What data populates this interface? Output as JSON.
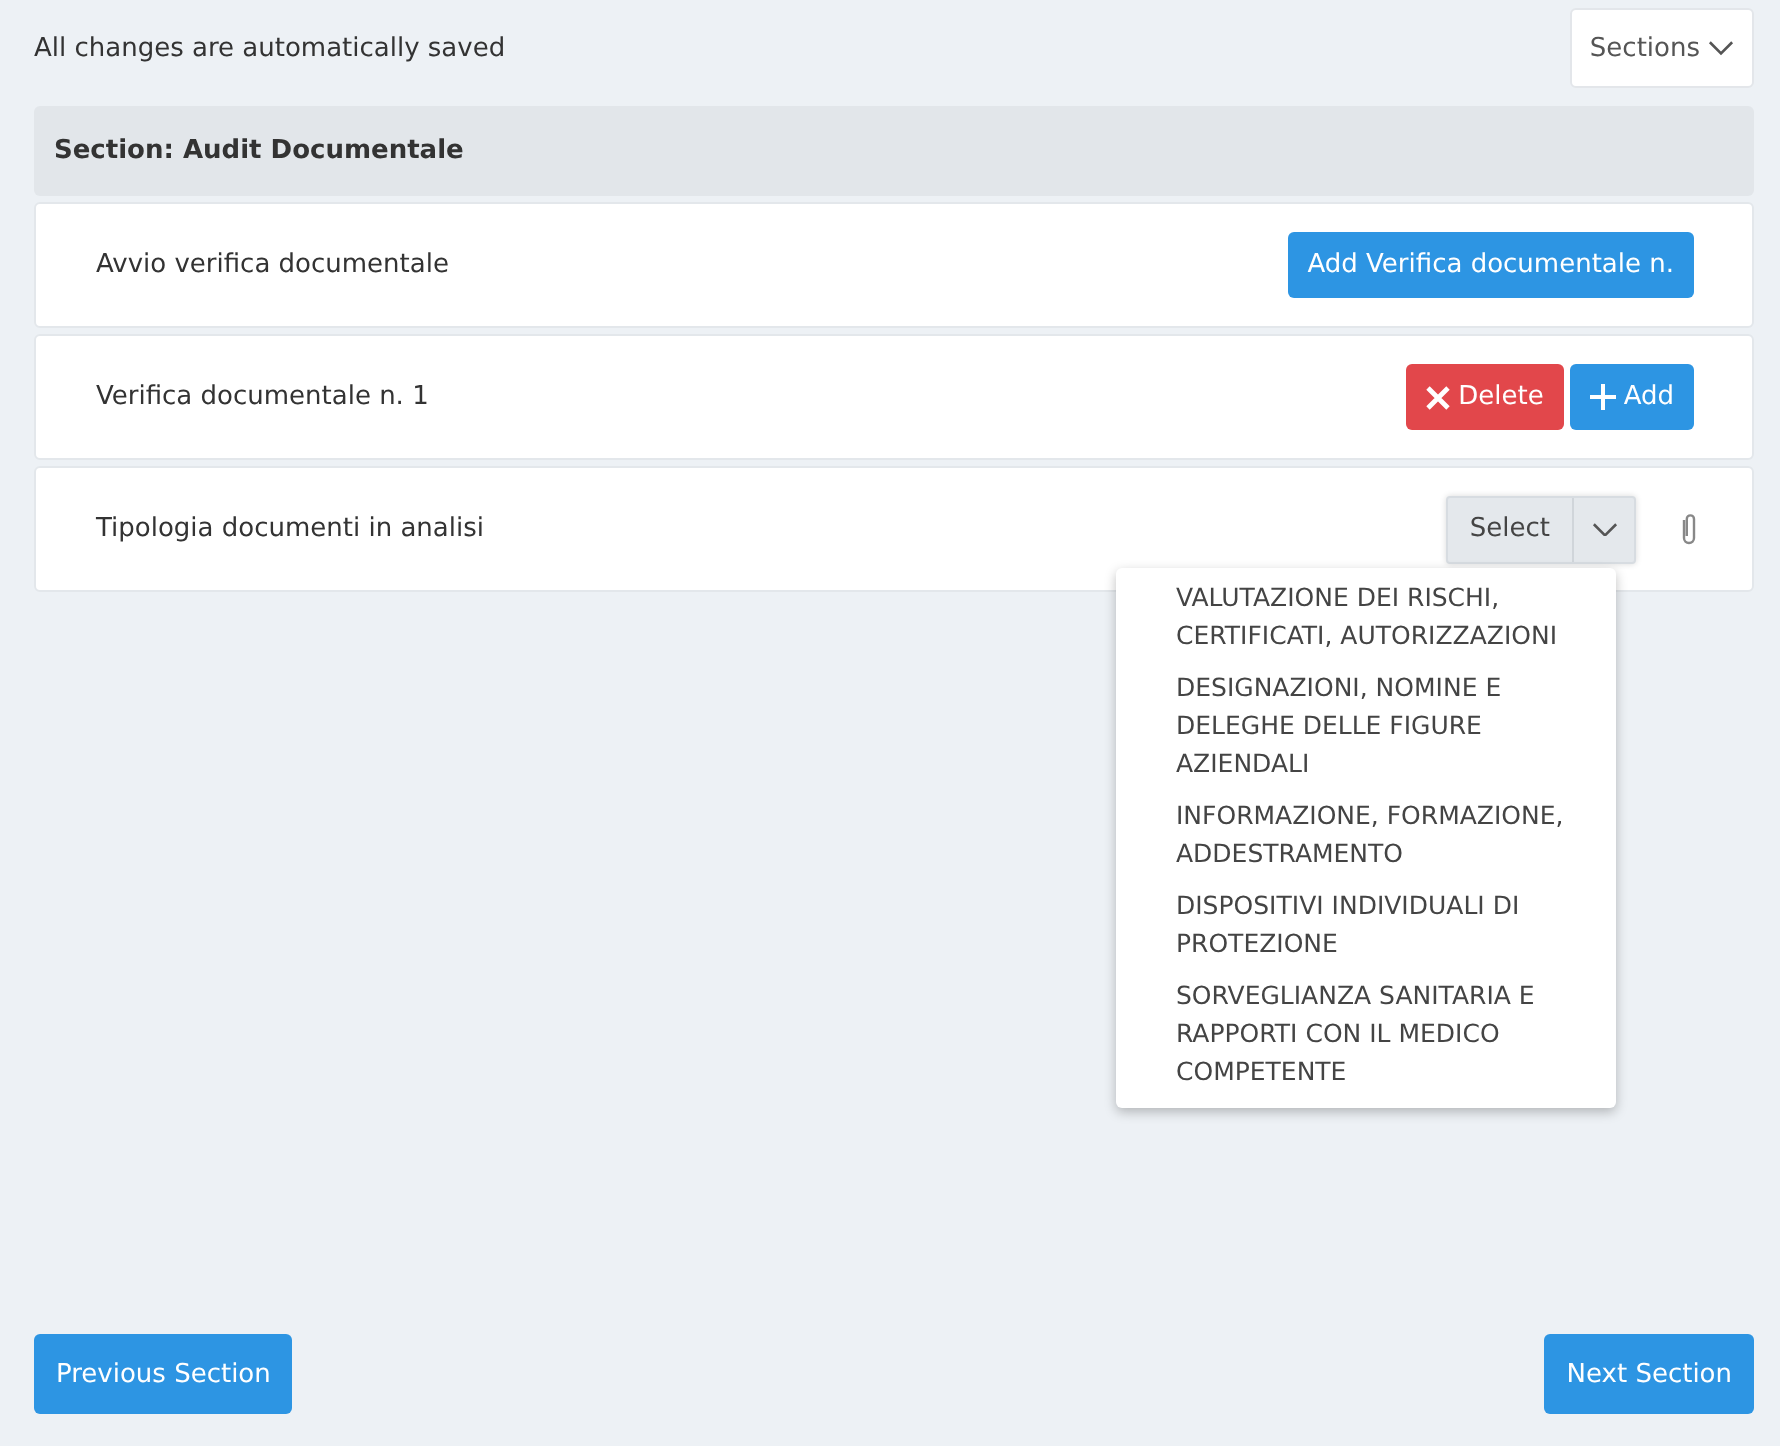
{
  "header": {
    "status": "All changes are automatically saved",
    "sections_button": "Sections"
  },
  "section": {
    "title": "Section: Audit Documentale"
  },
  "rows": [
    {
      "kind": "action",
      "label": "Avvio verifica documentale",
      "buttons": [
        {
          "kind": "primary",
          "label": "Add Verifica documentale n."
        }
      ]
    },
    {
      "kind": "action",
      "label": "Verifica documentale n. 1",
      "buttons": [
        {
          "kind": "delete",
          "label": "Delete"
        },
        {
          "kind": "add",
          "label": "Add"
        }
      ]
    },
    {
      "kind": "select",
      "label": "Tipologia documenti in analisi",
      "select": {
        "placeholder": "Select",
        "expanded": true,
        "options": [
          "VALUTAZIONE DEI RISCHI, CERTIFICATI, AUTORIZZAZIONI",
          "DESIGNAZIONI, NOMINE E DELEGHE DELLE FIGURE AZIENDALI",
          "INFORMAZIONE, FORMAZIONE, ADDESTRAMENTO",
          "DISPOSITIVI INDIVIDUALI DI PROTEZIONE",
          "SORVEGLIANZA SANITARIA E RAPPORTI CON IL MEDICO COMPETENTE"
        ]
      }
    }
  ],
  "footer": {
    "previous": "Previous Section",
    "next": "Next Section"
  }
}
